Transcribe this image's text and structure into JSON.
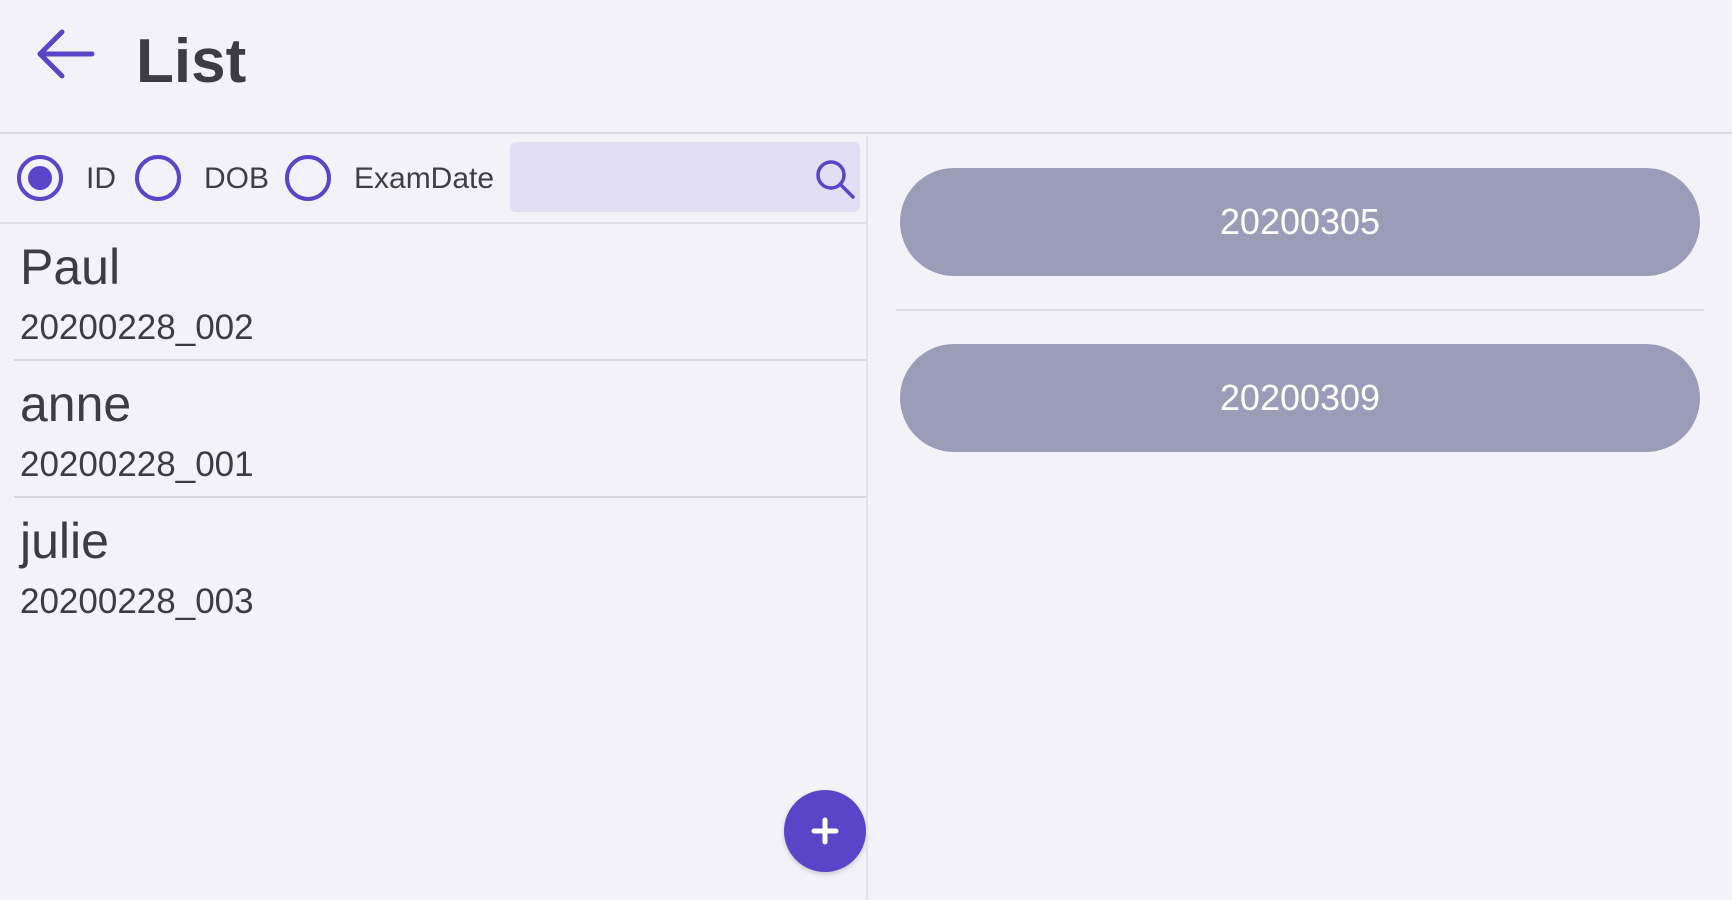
{
  "header": {
    "title": "List"
  },
  "filter": {
    "options": [
      {
        "label": "ID",
        "selected": true
      },
      {
        "label": "DOB",
        "selected": false
      },
      {
        "label": "ExamDate",
        "selected": false
      }
    ],
    "search": {
      "value": "",
      "placeholder": ""
    }
  },
  "patients": [
    {
      "name": "Paul",
      "id": "20200228_002"
    },
    {
      "name": "anne",
      "id": "20200228_001"
    },
    {
      "name": "julie",
      "id": "20200228_003"
    }
  ],
  "exam_dates": [
    "20200305",
    "20200309"
  ],
  "icons": {
    "back": "arrow-left-icon",
    "search": "search-icon",
    "add": "plus-icon"
  },
  "colors": {
    "accent": "#5a45c8",
    "background": "#f3f2f8",
    "date_button": "#9b9cb8",
    "search_field": "#e2def4"
  }
}
